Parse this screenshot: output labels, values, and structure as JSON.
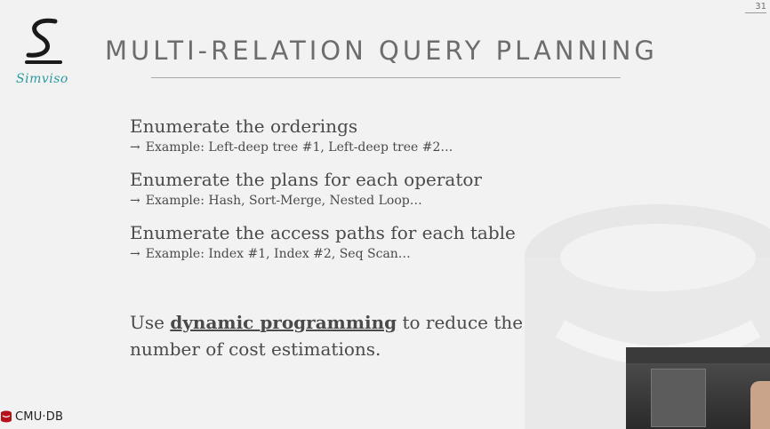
{
  "page_number": "31",
  "logo": {
    "text": "Simviso",
    "icon": "simviso-s-logo-icon",
    "accent_color": "#2a9aa3"
  },
  "title": "MULTI-RELATION QUERY PLANNING",
  "bullets": [
    {
      "text": "Enumerate the orderings",
      "sub": "Example: Left-deep tree #1, Left-deep tree #2…"
    },
    {
      "text": "Enumerate the plans for each operator",
      "sub": "Example: Hash, Sort-Merge, Nested Loop…"
    },
    {
      "text": "Enumerate the access paths for each table",
      "sub": "Example: Index #1, Index #2, Seq Scan…"
    }
  ],
  "arrow_glyph": "→",
  "note": {
    "prefix": "Use ",
    "highlight": "dynamic programming",
    "suffix": " to reduce the number of cost estimations."
  },
  "footer": {
    "brand": "CMU·DB",
    "icon": "cmu-db-database-icon"
  },
  "video_inset": {
    "icon": "lecturer-video-thumbnail"
  }
}
